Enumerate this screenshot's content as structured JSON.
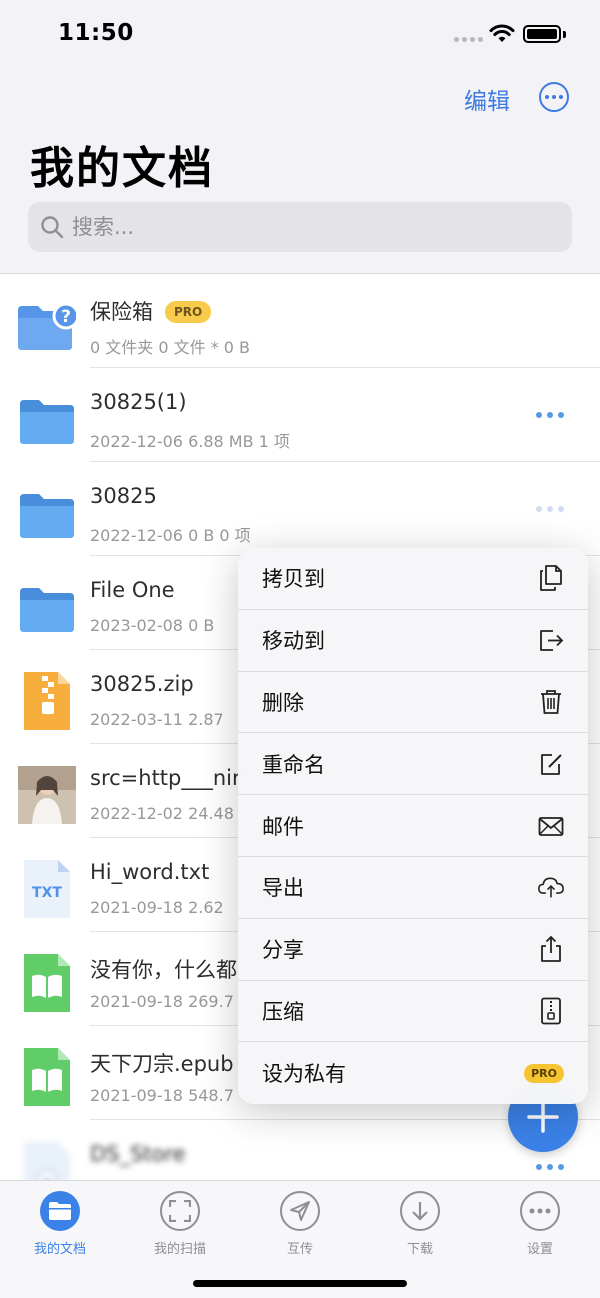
{
  "status": {
    "time": "11:50"
  },
  "header": {
    "edit_label": "编辑",
    "title": "我的文档",
    "search_placeholder": "搜索..."
  },
  "files": [
    {
      "name": "保险箱",
      "meta": "0 文件夹 0 文件 * 0 B",
      "badge": "PRO",
      "icon": "vault-folder-icon"
    },
    {
      "name": "30825(1)",
      "meta": "2022-12-06 6.88 MB  1 项",
      "icon": "folder-icon"
    },
    {
      "name": "30825",
      "meta": "2022-12-06 0 B  0 项",
      "icon": "folder-icon"
    },
    {
      "name": "File One",
      "meta": "2023-02-08 0 B",
      "icon": "folder-icon"
    },
    {
      "name": "30825.zip",
      "meta": "2022-03-11 2.87",
      "icon": "zip-file-icon"
    },
    {
      "name": "src=http___nir",
      "meta": "2022-12-02 24.48",
      "icon": "image-thumbnail"
    },
    {
      "name": "Hi_word.txt",
      "meta": "2021-09-18 2.62",
      "icon": "txt-file-icon",
      "icon_text": "TXT"
    },
    {
      "name": "没有你，什么都",
      "meta": "2021-09-18 269.7",
      "icon": "epub-file-icon"
    },
    {
      "name": "天下刀宗.epub",
      "meta": "2021-09-18 548.7",
      "icon": "epub-file-icon"
    },
    {
      "name": "DS_Store",
      "meta": "",
      "icon": "locked-file-icon"
    }
  ],
  "context_menu": [
    {
      "label": "拷贝到",
      "icon": "copy-icon"
    },
    {
      "label": "移动到",
      "icon": "move-icon"
    },
    {
      "label": "删除",
      "icon": "trash-icon"
    },
    {
      "label": "重命名",
      "icon": "rename-icon"
    },
    {
      "label": "邮件",
      "icon": "mail-icon"
    },
    {
      "label": "导出",
      "icon": "cloud-upload-icon"
    },
    {
      "label": "分享",
      "icon": "share-icon"
    },
    {
      "label": "压缩",
      "icon": "compress-icon"
    },
    {
      "label": "设为私有",
      "icon": "private-icon",
      "badge": "PRO"
    }
  ],
  "tabs": [
    {
      "label": "我的文档",
      "icon": "folder-tab-icon",
      "active": true
    },
    {
      "label": "我的扫描",
      "icon": "scan-icon"
    },
    {
      "label": "互传",
      "icon": "send-icon"
    },
    {
      "label": "下载",
      "icon": "download-icon"
    },
    {
      "label": "设置",
      "icon": "settings-icon"
    }
  ],
  "colors": {
    "accent": "#3b82e8",
    "pro_badge": "#f7c431",
    "folder_blue": "#4a9be8",
    "zip_orange": "#f7a321",
    "epub_green": "#4cc755"
  }
}
